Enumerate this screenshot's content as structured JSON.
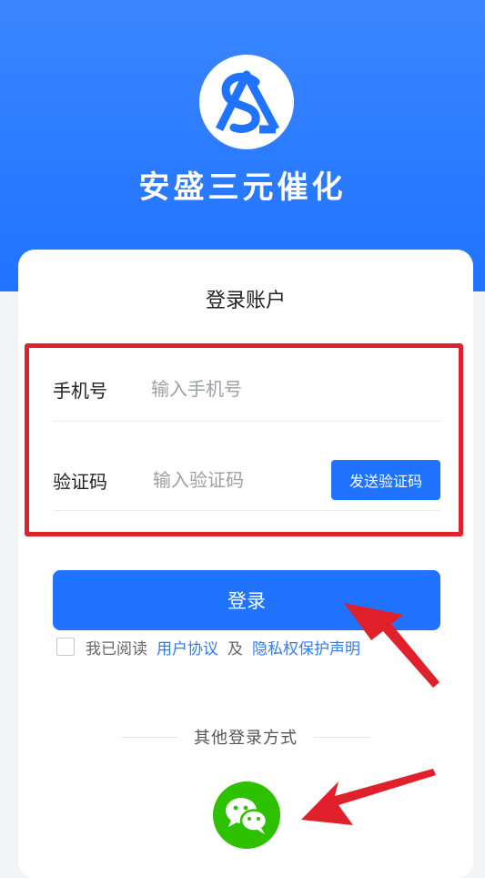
{
  "brand": {
    "name": "安盛三元催化",
    "logo_icon": "sa-logo-icon",
    "header_color": "#2a7dff"
  },
  "login": {
    "title": "登录账户",
    "phone": {
      "label": "手机号",
      "placeholder": "输入手机号"
    },
    "code": {
      "label": "验证码",
      "placeholder": "输入验证码",
      "send_button": "发送验证码"
    },
    "submit": "登录",
    "agreement": {
      "prefix": "我已阅读",
      "user_agreement": "用户协议",
      "and": "及",
      "privacy": "隐私权保护声明",
      "checked": false
    },
    "other_methods": {
      "label": "其他登录方式",
      "wechat_icon": "wechat-icon",
      "wechat_color": "#2dc100"
    }
  },
  "annotations": {
    "highlight_color": "#e0202a",
    "arrow_color": "#e0202a"
  }
}
